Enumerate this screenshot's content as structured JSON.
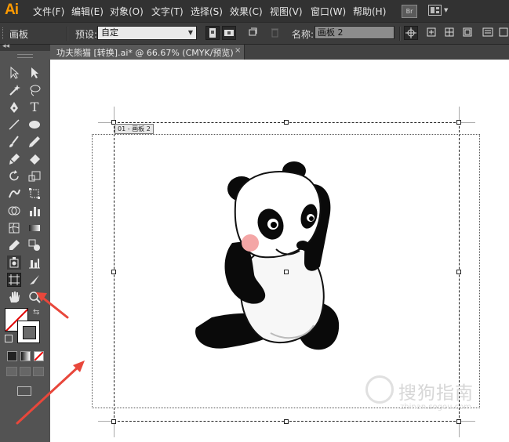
{
  "app": {
    "logo": "Ai"
  },
  "menu": [
    "文件(F)",
    "编辑(E)",
    "对象(O)",
    "文字(T)",
    "选择(S)",
    "效果(C)",
    "视图(V)",
    "窗口(W)",
    "帮助(H)"
  ],
  "menu_right": {
    "bridge_label": "Br",
    "workspace_icon": "workspace-switcher-icon"
  },
  "control_bar": {
    "title": "画板",
    "preset_label": "预设:",
    "preset_value": "自定",
    "name_label": "名称:",
    "name_value": "画板 2"
  },
  "document_tab": {
    "label": "功夫熊猫 [转换].ai* @ 66.67% (CMYK/预览)",
    "close": "×"
  },
  "artboard": {
    "label": "01 - 画板 2"
  },
  "watermark": {
    "text": "搜狗指南",
    "url": "zhinan.sogou.com"
  },
  "colors": {
    "accent": "#ff9a00",
    "arrow_red": "#e8473b",
    "panel": "#535353",
    "menubar": "#323232"
  }
}
